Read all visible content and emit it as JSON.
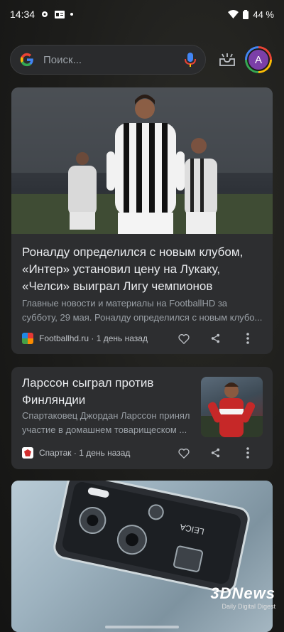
{
  "status_bar": {
    "time": "14:34",
    "battery_percent": "44 %",
    "icons": [
      "gear-icon",
      "news-icon",
      "dot-icon",
      "wifi-icon",
      "battery-icon"
    ]
  },
  "search": {
    "placeholder": "Поиск..."
  },
  "account": {
    "initial": "A"
  },
  "feed": {
    "cards": [
      {
        "headline": "Роналду определился с новым клубом, «Интер» установил цену на Лукаку, «Челси» выиграл Лигу чемпионов",
        "snippet": "Главные новости и материалы на FootballHD за субботу, 29 мая. Роналду определился с новым клубо...",
        "source": "Footballhd.ru · 1 день назад"
      },
      {
        "headline": "Ларссон сыграл против Финляндии",
        "snippet": "Спартаковец Джордан Ларссон принял участие в домашнем товарищеском ...",
        "source": "Спартак · 1 день назад"
      },
      {
        "image_text": "LEICA"
      }
    ]
  },
  "watermark": {
    "brand": "3DNews",
    "tagline": "Daily Digital Digest"
  },
  "colors": {
    "card_bg": "#2d2e30",
    "accent_avatar": "#7b3fa8"
  }
}
